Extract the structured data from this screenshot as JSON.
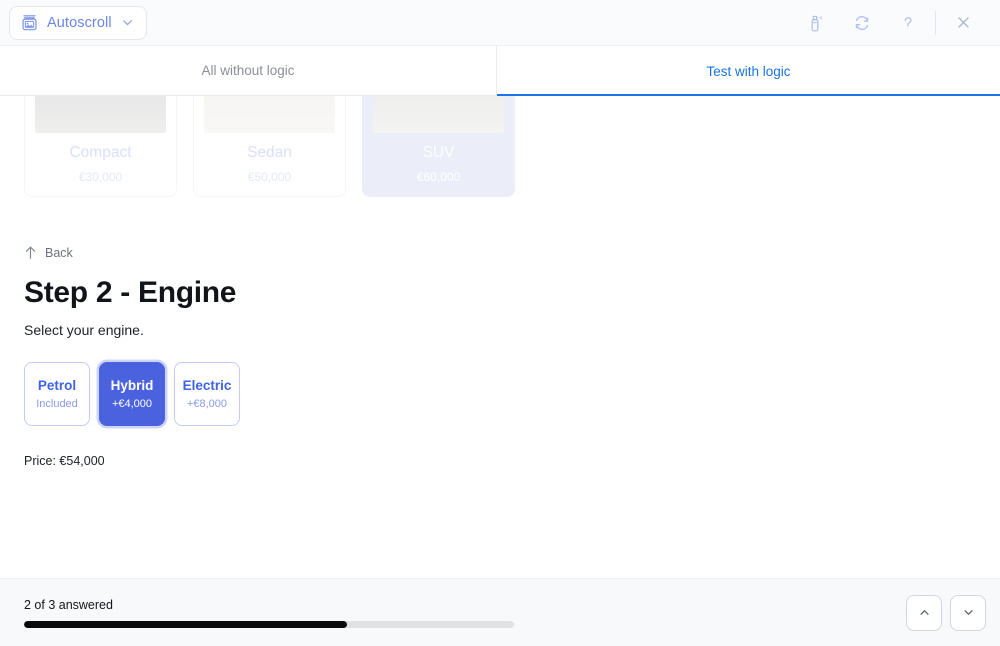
{
  "topbar": {
    "autoscroll_label": "Autoscroll",
    "autoscroll_icon": "window-image-icon",
    "chevron_icon": "chevron-down-icon",
    "actions": [
      {
        "name": "spray-clean-icon",
        "label": "Clean"
      },
      {
        "name": "refresh-icon",
        "label": "Restart"
      },
      {
        "name": "help-icon",
        "label": "Help"
      },
      {
        "name": "close-icon",
        "label": "Close"
      }
    ]
  },
  "tabs": [
    {
      "label": "All without logic",
      "active": false
    },
    {
      "label": "Test with logic",
      "active": true
    }
  ],
  "cards": {
    "items": [
      {
        "name": "Compact",
        "price": "€30,000",
        "selected": false
      },
      {
        "name": "Sedan",
        "price": "€50,000",
        "selected": false
      },
      {
        "name": "SUV",
        "price": "€60,000",
        "selected": true
      }
    ]
  },
  "step": {
    "back_label": "Back",
    "back_icon": "arrow-up-icon",
    "title": "Step 2 - Engine",
    "subtitle": "Select your engine.",
    "price_line": "Price: €54,000",
    "options": [
      {
        "name": "Petrol",
        "extra": "Included",
        "selected": false
      },
      {
        "name": "Hybrid",
        "extra": "+€4,000",
        "selected": true
      },
      {
        "name": "Electric",
        "extra": "+€8,000",
        "selected": false
      }
    ]
  },
  "footer": {
    "progress_label": "2 of 3 answered",
    "progress_percent": 66,
    "prev_icon": "chevron-up-icon",
    "next_icon": "chevron-down-icon"
  },
  "colors": {
    "accent_blue": "#1a73e8",
    "option_blue": "#4a62dd",
    "selected_card": "#c5cef0",
    "progress_fill": "#0a0a0a"
  }
}
